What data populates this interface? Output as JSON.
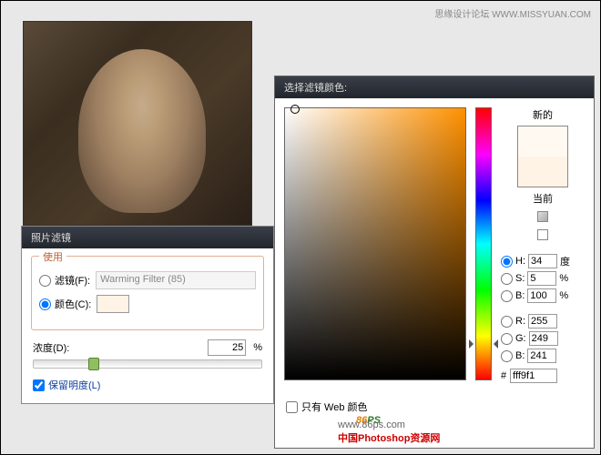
{
  "topbar": {
    "text": "思缘设计论坛 WWW.MISSYUAN.COM"
  },
  "photoFilterPanel": {
    "title": "照片滤镜",
    "useGroupLegend": "使用",
    "filterLabel": "滤镜(F):",
    "filterValue": "Warming Filter (85)",
    "colorLabel": "颜色(C):",
    "swatchHex": "#fff3e6",
    "densityLabel": "浓度(D):",
    "densityValue": "25",
    "densityUnit": "%",
    "preserveLabel": "保留明度(L)"
  },
  "colorPicker": {
    "title": "选择滤镜颜色:",
    "newLabel": "新的",
    "currentLabel": "当前",
    "swatchNew": "#fff9f1",
    "swatchCurrent": "#fff3e6",
    "fields": {
      "H": {
        "label": "H:",
        "value": "34",
        "unit": "度"
      },
      "S": {
        "label": "S:",
        "value": "5",
        "unit": "%"
      },
      "B": {
        "label": "B:",
        "value": "100",
        "unit": "%"
      },
      "R": {
        "label": "R:",
        "value": "255",
        "unit": ""
      },
      "G": {
        "label": "G:",
        "value": "249",
        "unit": ""
      },
      "Bb": {
        "label": "B:",
        "value": "241",
        "unit": ""
      }
    },
    "hexPrefix": "#",
    "hexValue": "fff9f1",
    "webOnlyLabel": "只有 Web 颜色"
  },
  "watermark": {
    "logo": "86",
    "logoSuffix": "PS",
    "url": "www.86ps.com",
    "desc": "中国Photoshop资源网"
  }
}
